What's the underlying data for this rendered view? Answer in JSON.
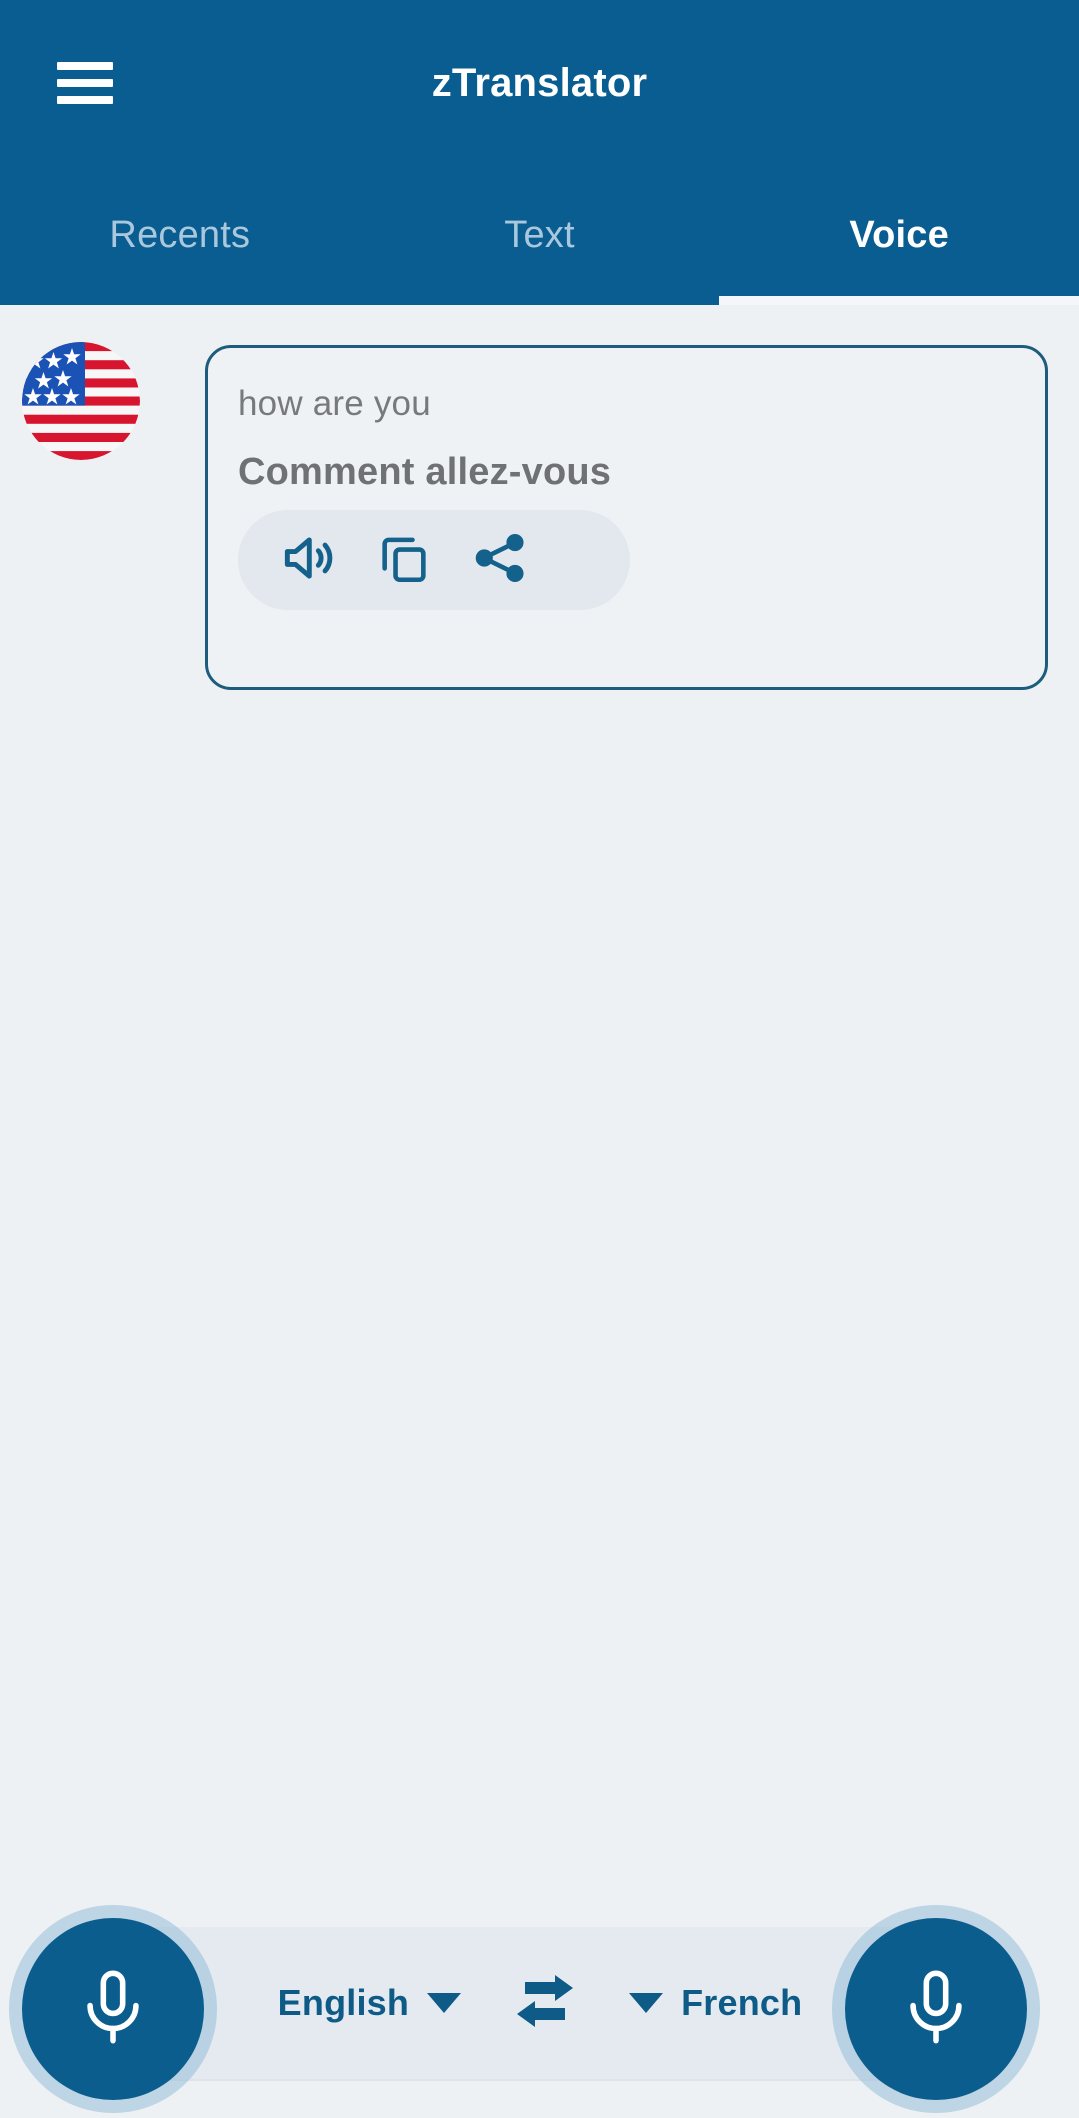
{
  "app": {
    "title": "zTranslator",
    "menu_icon": "hamburger-menu-icon",
    "header_color": "#0a5d90",
    "background_color": "#eef1f4",
    "accent_color": "#0d5b86"
  },
  "tabs": [
    {
      "label": "Recents",
      "active": false
    },
    {
      "label": "Text",
      "active": false
    },
    {
      "label": "Voice",
      "active": true
    }
  ],
  "translation": {
    "flag_icon": "us-flag-icon",
    "source_text": "how are you",
    "translated_text": "Comment allez-vous",
    "actions": [
      {
        "icon": "speaker-icon",
        "label": "Speak"
      },
      {
        "icon": "copy-icon",
        "label": "Copy"
      },
      {
        "icon": "share-icon",
        "label": "Share"
      }
    ]
  },
  "bottom_bar": {
    "source_language": "English",
    "target_language": "French",
    "swap_icon": "swap-arrows-icon",
    "caret_icon": "chevron-down-icon",
    "mic_left_icon": "microphone-icon",
    "mic_right_icon": "microphone-icon"
  }
}
